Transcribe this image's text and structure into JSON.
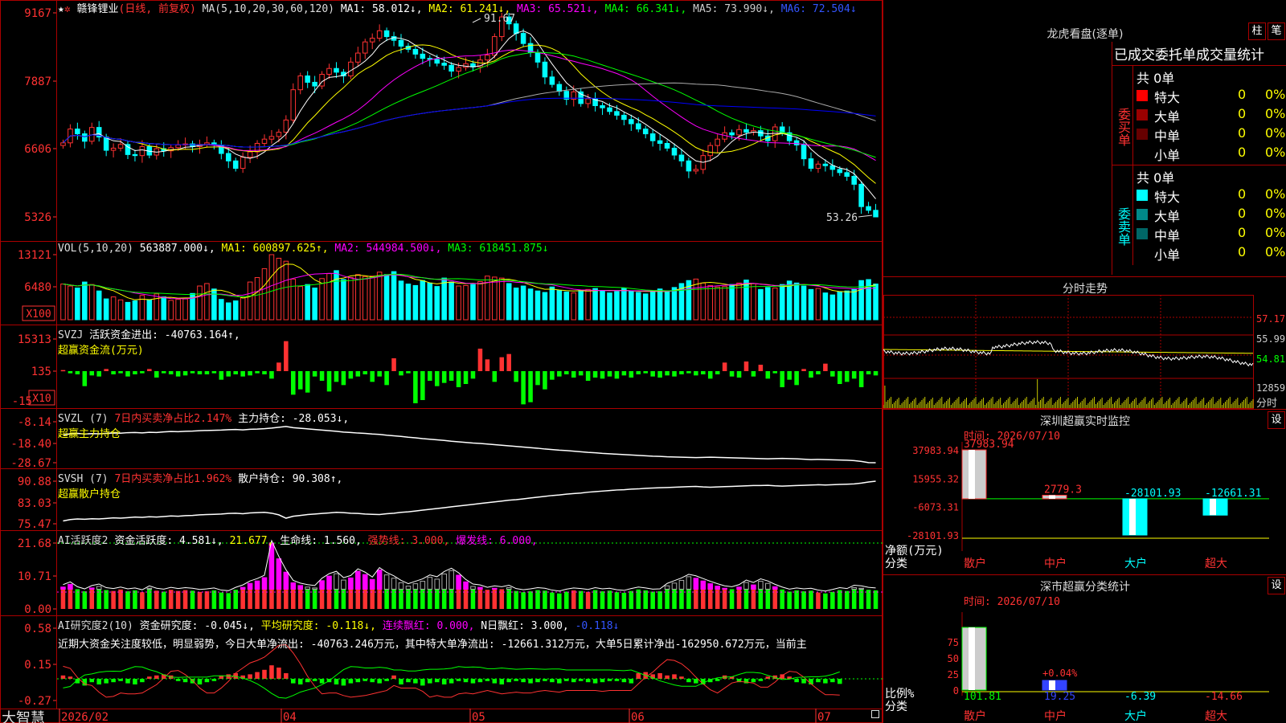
{
  "colors": {
    "up": "#ff3232",
    "down": "#00ffff",
    "ma1": "#ffffff",
    "ma2": "#ffff00",
    "ma3": "#ff00ff",
    "ma4": "#00ff00",
    "ma5": "#aaaaaa",
    "ma6": "#0000ff",
    "grid": "#aa0000",
    "axis": "#ff3232",
    "green": "#00ff00"
  },
  "main": {
    "stock_name": "赣锋锂业",
    "mode": "(日线, 前复权)",
    "ma_params": "MA(5,10,20,30,60,120)",
    "ma1": "MA1: 58.012↓,",
    "ma2": "MA2: 61.241↓,",
    "ma3": "MA3: 65.521↓,",
    "ma4": "MA4: 66.341↓,",
    "ma5": "MA5: 73.990↓,",
    "ma6": "MA6: 72.504↓",
    "high_label": "91.67",
    "low_label": "53.26",
    "y_ticks": [
      "9167",
      "7887",
      "6606",
      "5326"
    ]
  },
  "vol": {
    "title": "VOL(5,10,20)",
    "value": "563887.000↓,",
    "ma1": "MA1: 600897.625↑,",
    "ma2": "MA2: 544984.500↓,",
    "ma3": "MA3: 618451.875↓",
    "y_ticks": [
      "13121",
      "6480"
    ],
    "unit": "X100"
  },
  "svzj": {
    "title": "SVZJ",
    "label": "活跃资金进出: -40763.164↑,",
    "sub": "超赢资金流(万元)",
    "y_ticks": [
      "15313",
      "135",
      "-15"
    ],
    "unit": "X10"
  },
  "svzl": {
    "title": "SVZL (7)",
    "label1": "7日内买卖净占比2.147%",
    "label2": "主力持仓: -28.053↓,",
    "sub": "超赢主力持仓",
    "y_ticks": [
      "-8.14",
      "-18.40",
      "-28.67"
    ]
  },
  "svsh": {
    "title": "SVSH (7)",
    "label1": "7日内买卖净占比1.962%",
    "label2": "散户持仓: 90.308↑,",
    "sub": "超赢散户持仓",
    "y_ticks": [
      "90.88",
      "83.03",
      "75.47"
    ]
  },
  "ai1": {
    "title": "AI活跃度2",
    "label1": "资金活跃度: 4.581↓,",
    "label2": "21.677,",
    "label3": "生命线: 1.560,",
    "label4": "强势线: 3.000,",
    "label5": "爆发线: 6.000,",
    "y_ticks": [
      "21.68",
      "10.71",
      "0.00"
    ]
  },
  "ai2": {
    "title": "AI研究度2(10)",
    "label1": "资金研究度: -0.045↓,",
    "label2": "平均研究度: -0.118↓,",
    "label3": "连续飘红: 0.000,",
    "label4": "N日飘红: 3.000,",
    "label5": "-0.118↓",
    "comment": "近期大资金关注度较低，明显弱势，今日大单净流出: -40763.246万元，其中特大单净流出: -12661.312万元，大单5日累计净出-162950.672万元，当前主",
    "y_ticks": [
      "0.58",
      "0.15",
      "-0.27"
    ]
  },
  "xaxis": {
    "brand": "大智慧",
    "labels": [
      "2026/02",
      "04",
      "05",
      "06",
      "07"
    ]
  },
  "lhb": {
    "title": "龙虎看盘(逐单)",
    "tab1": "柱",
    "tab2": "笔",
    "header": "已成交委托单成交量统计",
    "buy_side": "委买单",
    "sell_side": "委卖单",
    "buy_total": "共 0单",
    "sell_total": "共 0单",
    "buy_rows": [
      {
        "label": "特大",
        "count": "0",
        "pct": "0%",
        "color": "#ff0000"
      },
      {
        "label": "大单",
        "count": "0",
        "pct": "0%",
        "color": "#990000"
      },
      {
        "label": "中单",
        "count": "0",
        "pct": "0%",
        "color": "#660000"
      },
      {
        "label": "小单",
        "count": "0",
        "pct": "0%",
        "color": "#000000"
      }
    ],
    "sell_rows": [
      {
        "label": "特大",
        "count": "0",
        "pct": "0%",
        "color": "#00ffff"
      },
      {
        "label": "大单",
        "count": "0",
        "pct": "0%",
        "color": "#008888"
      },
      {
        "label": "中单",
        "count": "0",
        "pct": "0%",
        "color": "#006666"
      },
      {
        "label": "小单",
        "count": "0",
        "pct": "0%",
        "color": "#000000"
      }
    ]
  },
  "intraday": {
    "title": "分时走势",
    "y_ticks": [
      "57.17",
      "55.99",
      "54.81",
      "12859"
    ],
    "unit": "分时"
  },
  "monitor": {
    "title": "深圳超赢实时监控",
    "settings": "设",
    "date": "时间: 2026/07/10",
    "y_ticks": [
      "37983.94",
      "15955.32",
      "-6073.31",
      "-28101.93"
    ],
    "ylabel": "净额(万元)",
    "xlabel": "分类",
    "categories": [
      "散户",
      "中户",
      "大户",
      "超大"
    ],
    "values": [
      "37983.94",
      "2779.3",
      "-28101.93",
      "-12661.31"
    ]
  },
  "classify": {
    "title": "深市超赢分类统计",
    "settings": "设",
    "date": "时间: 2026/07/10",
    "y_ticks": [
      "75",
      "50",
      "25",
      "0"
    ],
    "ylabel": "比例%",
    "xlabel": "分类",
    "categories": [
      "散户",
      "中户",
      "大户",
      "超大"
    ],
    "values": [
      "101.81",
      "19.25",
      "-6.39",
      "-14.66"
    ],
    "annotation": "+0.04%"
  },
  "chart_data": [
    {
      "type": "candlestick",
      "title": "赣锋锂业",
      "y_range": [
        53.26,
        91.67
      ],
      "dates_note": "daily, 2026/02 to 2026/07",
      "close": [
        67.2,
        69.8,
        68.9,
        67.5,
        70.1,
        68.3,
        65.8,
        66.2,
        66.9,
        65.0,
        64.8,
        66.5,
        64.9,
        66.1,
        65.7,
        66.3,
        66.8,
        67.0,
        66.5,
        66.9,
        67.2,
        66.8,
        65.2,
        63.8,
        62.4,
        64.5,
        65.5,
        67.1,
        67.9,
        68.4,
        69.2,
        71.5,
        77.2,
        79.8,
        78.6,
        77.9,
        80.1,
        81.2,
        80.5,
        79.8,
        82.4,
        84.1,
        86.2,
        86.9,
        88.3,
        87.2,
        86.5,
        85.4,
        84.8,
        83.9,
        83.1,
        82.9,
        82.2,
        81.8,
        80.7,
        81.4,
        82.1,
        81.5,
        82.8,
        83.7,
        87.2,
        90.9,
        89.6,
        87.8,
        85.9,
        84.2,
        82.4,
        79.6,
        78.2,
        76.9,
        75.4,
        76.8,
        74.6,
        75.5,
        74.2,
        73.8,
        73.1,
        72.4,
        71.6,
        70.8,
        69.8,
        68.9,
        67.6,
        67.1,
        66.2,
        64.9,
        63.8,
        61.9,
        62.2,
        64.8,
        66.7,
        67.9,
        69.1,
        68.7,
        69.7,
        69.2,
        69.5,
        68.5,
        67.6,
        70.2,
        69.1,
        67.6,
        66.8,
        64.2,
        62.4,
        63.2,
        62.9,
        62.2,
        61.6,
        60.9,
        59.4,
        55.2,
        54.5,
        53.26
      ]
    },
    {
      "type": "bar",
      "title": "VOL(5,10,20)",
      "y_range": [
        0,
        13121
      ],
      "values": [
        7200,
        6800,
        6400,
        7600,
        7100,
        5800,
        4200,
        4600,
        4000,
        3500,
        3800,
        4900,
        4000,
        5200,
        4600,
        3900,
        4100,
        4200,
        5300,
        6800,
        7300,
        6200,
        4100,
        3400,
        3800,
        4400,
        7600,
        8500,
        10300,
        13121,
        12400,
        11800,
        8200,
        6700,
        7100,
        6400,
        8300,
        9300,
        9900,
        8100,
        8500,
        9100,
        8700,
        8800,
        9600,
        9100,
        9700,
        7800,
        7200,
        6900,
        7900,
        7400,
        6700,
        8400,
        7600,
        6800,
        6900,
        7100,
        7700,
        8800,
        8600,
        8400,
        7300,
        6400,
        6800,
        6200,
        5800,
        5500,
        6600,
        5900,
        5600,
        5400,
        5900,
        6100,
        6300,
        5900,
        5400,
        5700,
        6400,
        5800,
        5500,
        5200,
        5800,
        6200,
        5700,
        6500,
        7300,
        7900,
        8200,
        7400,
        6900,
        6600,
        6700,
        7100,
        7400,
        8000,
        7300,
        6100,
        6500,
        6400,
        7100,
        7800,
        7400,
        6800,
        6100,
        6300,
        5400,
        5000,
        5600,
        5800,
        6200,
        7900,
        8100,
        7200
      ]
    },
    {
      "type": "bar",
      "title": "SVZJ",
      "y_range": [
        -15,
        15313
      ],
      "values": [
        100,
        -200,
        -300,
        -1400,
        -400,
        -500,
        200,
        -300,
        -200,
        -500,
        -300,
        -200,
        200,
        -600,
        -200,
        -300,
        -500,
        -400,
        -200,
        -300,
        -300,
        -200,
        -800,
        -500,
        -300,
        -500,
        -400,
        -200,
        -300,
        -700,
        800,
        2800,
        -2200,
        -1700,
        -2000,
        -500,
        -900,
        -1900,
        -1000,
        -1300,
        -700,
        -500,
        -300,
        -1000,
        -500,
        -1300,
        1200,
        -400,
        -200,
        -3000,
        -2700,
        -900,
        -1400,
        -1100,
        -900,
        -1500,
        -1200,
        -700,
        2100,
        1100,
        -1000,
        1300,
        1600,
        -1000,
        -3100,
        -2900,
        -1300,
        -1700,
        -800,
        -500,
        -300,
        -600,
        -400,
        -900,
        -600,
        -700,
        -500,
        -700,
        -400,
        -600,
        -300,
        -200,
        -500,
        -600,
        -400,
        -500,
        -300,
        -200,
        -400,
        -300,
        -700,
        -300,
        800,
        -500,
        -600,
        900,
        -500,
        600,
        -700,
        -200,
        -1500,
        -800,
        -1300,
        200,
        -600,
        -300,
        700,
        -500,
        -1200,
        -1000,
        -700,
        -1500,
        -300,
        -400
      ]
    },
    {
      "type": "line",
      "title": "SVZL (7)",
      "y_range": [
        -28.67,
        -8.14
      ],
      "series": [
        {
          "name": "主力持仓",
          "values": [
            -14.8,
            -14.2,
            -14.0,
            -14.3,
            -14.1,
            -14.2,
            -14.0,
            -13.8,
            -13.9,
            -13.6,
            -13.5,
            -13.7,
            -13.4,
            -13.5,
            -13.2,
            -13.0,
            -13.1,
            -12.9,
            -12.8,
            -12.6,
            -12.5,
            -12.4,
            -12.3,
            -12.1,
            -12.0,
            -12.2,
            -11.9,
            -11.8,
            -11.6,
            -11.3,
            -10.9,
            -10.5,
            -11.1,
            -11.4,
            -11.7,
            -12.0,
            -12.3,
            -12.6,
            -12.9,
            -13.3,
            -13.5,
            -13.8,
            -14.0,
            -14.3,
            -14.5,
            -14.9,
            -15.2,
            -15.5,
            -15.9,
            -16.2,
            -16.6,
            -16.9,
            -17.2,
            -17.5,
            -17.9,
            -18.2,
            -18.5,
            -18.8,
            -19.0,
            -19.3,
            -19.6,
            -19.9,
            -20.2,
            -20.5,
            -20.8,
            -21.1,
            -21.4,
            -21.8,
            -22.1,
            -22.4,
            -22.6,
            -22.9,
            -23.2,
            -23.5,
            -23.7,
            -24.0,
            -24.2,
            -24.4,
            -24.6,
            -24.8,
            -25.0,
            -25.2,
            -25.4,
            -25.5,
            -25.7,
            -25.8,
            -25.9,
            -26.0,
            -26.1,
            -26.0,
            -25.9,
            -26.0,
            -26.1,
            -26.2,
            -26.3,
            -26.4,
            -26.5,
            -26.6,
            -26.7,
            -26.6,
            -26.5,
            -26.6,
            -26.7,
            -26.9,
            -27.1,
            -27.0,
            -27.1,
            -27.2,
            -27.3,
            -27.4,
            -27.6,
            -28.0,
            -28.6,
            -28.67
          ]
        }
      ]
    },
    {
      "type": "line",
      "title": "SVSH (7)",
      "y_range": [
        75.47,
        90.88
      ],
      "series": [
        {
          "name": "散户持仓",
          "values": [
            76.5,
            77.0,
            77.2,
            77.1,
            77.3,
            77.2,
            77.4,
            77.6,
            77.5,
            77.7,
            77.9,
            77.8,
            78.0,
            77.9,
            78.1,
            78.3,
            78.2,
            78.4,
            78.5,
            78.7,
            78.8,
            78.9,
            79.0,
            79.2,
            79.3,
            79.1,
            79.4,
            79.5,
            79.6,
            79.3,
            78.7,
            77.5,
            78.2,
            78.5,
            78.8,
            79.0,
            79.2,
            79.4,
            79.6,
            79.5,
            79.3,
            79.2,
            79.0,
            78.9,
            78.8,
            79.1,
            79.3,
            79.6,
            79.8,
            80.1,
            80.4,
            80.7,
            81.0,
            81.3,
            81.6,
            81.9,
            82.2,
            82.5,
            82.8,
            83.1,
            83.4,
            83.7,
            84.0,
            84.2,
            84.5,
            84.8,
            85.1,
            85.4,
            85.7,
            85.9,
            86.2,
            86.4,
            86.6,
            86.9,
            87.1,
            87.3,
            87.5,
            87.7,
            87.8,
            88.0,
            88.1,
            88.3,
            88.4,
            88.5,
            88.6,
            88.7,
            88.8,
            88.9,
            89.0,
            88.8,
            88.7,
            88.8,
            88.9,
            89.0,
            89.1,
            89.2,
            89.3,
            89.3,
            89.4,
            89.2,
            89.1,
            89.2,
            89.3,
            89.4,
            89.5,
            89.6,
            89.5,
            89.6,
            89.7,
            89.8,
            89.9,
            90.2,
            90.6,
            90.88
          ]
        }
      ]
    },
    {
      "type": "bar",
      "title": "AI活跃度2",
      "y_range": [
        0,
        21.68
      ],
      "values": [
        7.2,
        8.1,
        6.5,
        5.8,
        6.9,
        7.4,
        6.2,
        5.9,
        6.4,
        5.8,
        6.1,
        5.5,
        6.8,
        6.0,
        5.7,
        6.3,
        5.9,
        6.2,
        6.0,
        5.6,
        5.8,
        6.1,
        5.4,
        5.2,
        6.3,
        7.1,
        8.4,
        9.2,
        10.3,
        21.68,
        16.5,
        12.1,
        8.6,
        7.7,
        7.2,
        6.9,
        9.3,
        10.8,
        11.6,
        9.5,
        10.2,
        12.4,
        11.3,
        9.7,
        12.8,
        11.2,
        10.1,
        8.6,
        7.5,
        8.3,
        9.1,
        10.4,
        9.8,
        11.5,
        12.6,
        11.1,
        8.9,
        7.4,
        7.1,
        6.3,
        6.8,
        6.5,
        7.0,
        5.9,
        5.5,
        5.8,
        6.2,
        6.0,
        5.4,
        5.1,
        5.7,
        6.1,
        5.9,
        5.6,
        6.2,
        5.8,
        6.0,
        5.5,
        5.3,
        5.9,
        6.4,
        6.1,
        5.7,
        5.8,
        7.6,
        8.5,
        9.4,
        10.6,
        10.1,
        9.2,
        8.3,
        7.5,
        6.8,
        6.5,
        7.2,
        8.7,
        7.9,
        9.1,
        8.4,
        7.3,
        6.4,
        5.7,
        6.1,
        5.8,
        6.0,
        5.4,
        5.1,
        5.6,
        6.2,
        5.9,
        7.0,
        6.8,
        6.3,
        6.1
      ]
    },
    {
      "type": "bar",
      "title": "AI研究度2(10)",
      "y_range": [
        -0.27,
        0.58
      ],
      "values": [
        0.03,
        0.02,
        -0.04,
        -0.06,
        -0.03,
        -0.05,
        -0.04,
        -0.03,
        -0.02,
        -0.04,
        -0.05,
        -0.03,
        0.02,
        0.03,
        0.04,
        0.03,
        -0.02,
        -0.03,
        -0.04,
        -0.05,
        -0.03,
        -0.02,
        0.03,
        0.04,
        0.05,
        0.03,
        0.04,
        0.06,
        0.08,
        0.12,
        0.1,
        0.05,
        -0.04,
        -0.05,
        -0.03,
        -0.02,
        -0.04,
        -0.03,
        -0.05,
        -0.06,
        -0.04,
        -0.03,
        -0.02,
        -0.03,
        -0.04,
        -0.02,
        0.03,
        -0.05,
        -0.03,
        -0.04,
        -0.06,
        -0.04,
        -0.03,
        -0.05,
        -0.04,
        -0.02,
        -0.03,
        -0.04,
        -0.03,
        -0.02,
        -0.04,
        -0.05,
        -0.03,
        -0.02,
        -0.03,
        -0.04,
        -0.03,
        -0.02,
        -0.03,
        -0.04,
        -0.02,
        -0.03,
        -0.02,
        -0.03,
        -0.04,
        -0.03,
        -0.02,
        -0.02,
        -0.03,
        -0.04,
        0.05,
        0.06,
        0.04,
        0.05,
        0.03,
        0.04,
        0.02,
        -0.03,
        -0.04,
        -0.05,
        -0.03,
        -0.02,
        0.03,
        0.02,
        -0.03,
        -0.04,
        -0.03,
        -0.02,
        0.02,
        0.03,
        0.04,
        0.02,
        -0.03,
        -0.04,
        -0.05,
        -0.03,
        -0.04,
        -0.03,
        -0.045
      ]
    },
    {
      "type": "bar",
      "title": "深圳超赢实时监控",
      "categories": [
        "散户",
        "中户",
        "大户",
        "超大"
      ],
      "values": [
        37983.94,
        2779.3,
        -28101.93,
        -12661.31
      ],
      "ylim": [
        -28101.93,
        37983.94
      ]
    },
    {
      "type": "bar",
      "title": "深市超赢分类统计",
      "categories": [
        "散户",
        "中户",
        "大户",
        "超大"
      ],
      "values": [
        101.81,
        19.25,
        -6.39,
        -14.66
      ],
      "ylim": [
        0,
        75
      ]
    }
  ]
}
